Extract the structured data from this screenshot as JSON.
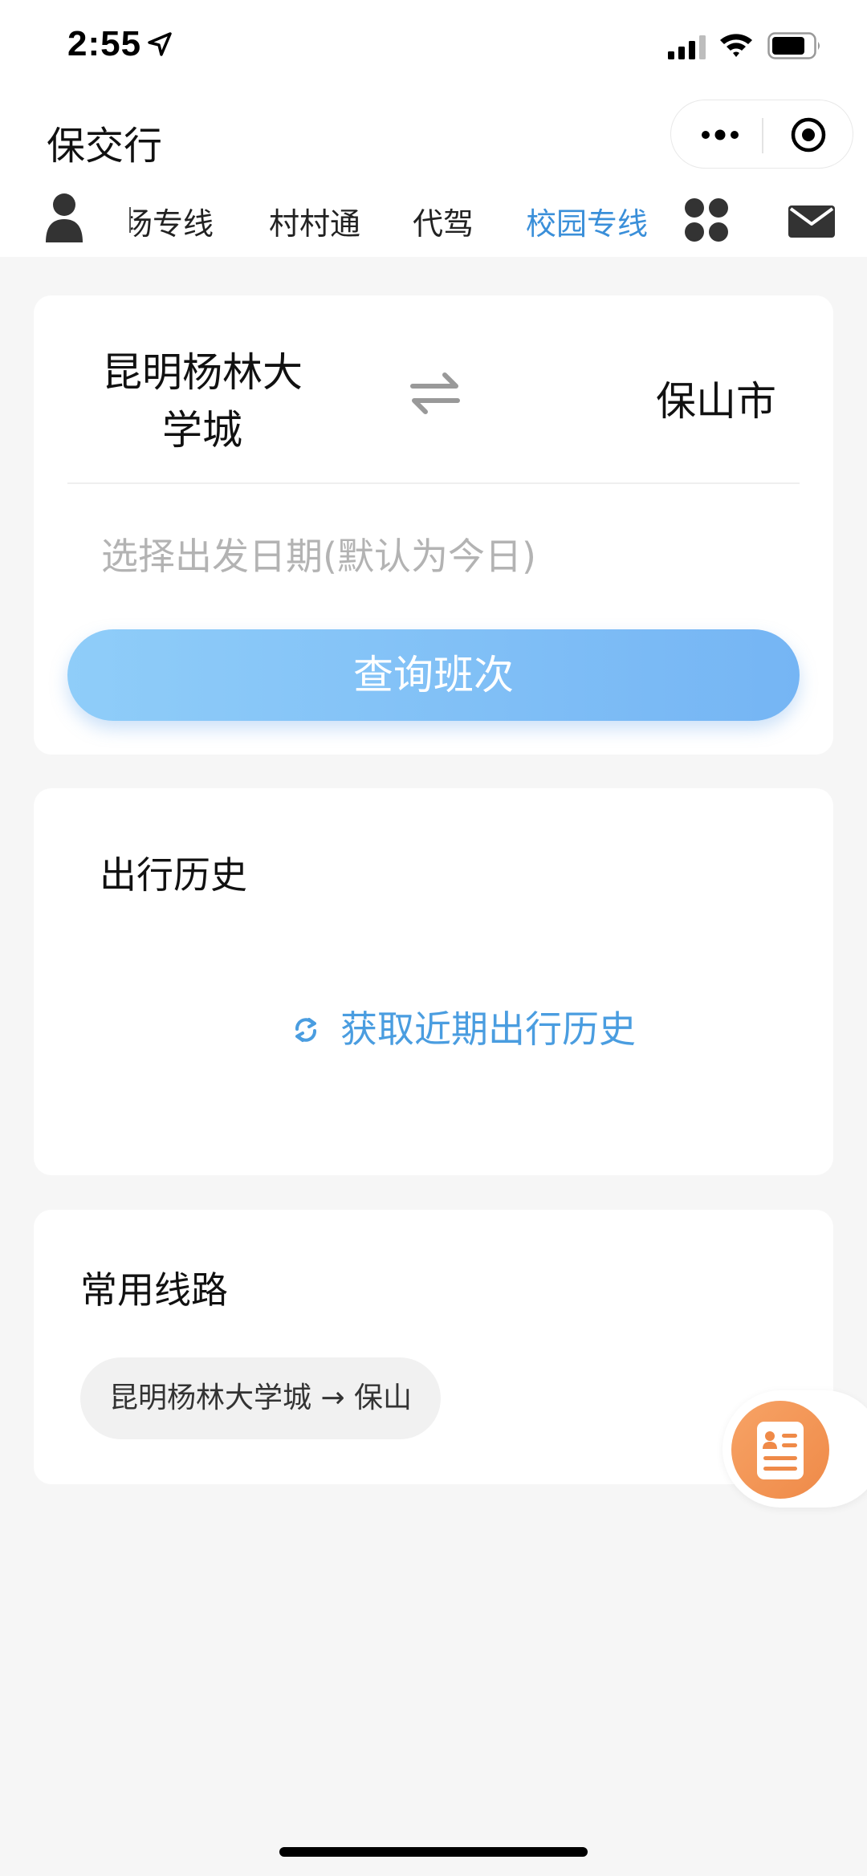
{
  "status_bar": {
    "time": "2:55",
    "icons": [
      "location-arrow-icon",
      "cellular-signal-icon",
      "wifi-icon",
      "battery-icon"
    ]
  },
  "header": {
    "title": "保交行",
    "menu_icons": [
      "more-icon",
      "target-icon"
    ]
  },
  "nav": {
    "tabs": [
      {
        "label": "机场专线",
        "active": false
      },
      {
        "label": "村村通",
        "active": false
      },
      {
        "label": "代驾",
        "active": false
      },
      {
        "label": "校园专线",
        "active": true
      }
    ],
    "icons": [
      "user-icon",
      "apps-icon",
      "mail-icon"
    ],
    "active_color": "#3a8fd9"
  },
  "search": {
    "from": "昆明杨林大学城",
    "to": "保山市",
    "date_placeholder": "选择出发日期(默认为今日)",
    "query_button": "查询班次",
    "button_color": "#7ab8f5"
  },
  "history": {
    "title": "出行历史",
    "refresh_label": "获取近期出行历史",
    "link_color": "#4a9de0"
  },
  "routes": {
    "title": "常用线路",
    "items": [
      "昆明杨林大学城 → 保山"
    ]
  },
  "float_button": {
    "icon": "document-icon",
    "color": "#f0904c"
  }
}
